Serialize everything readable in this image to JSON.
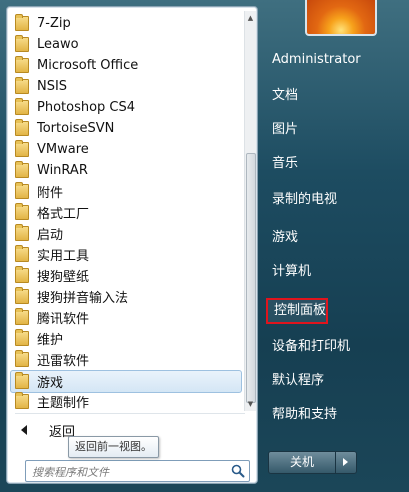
{
  "programs": [
    {
      "label": "7-Zip"
    },
    {
      "label": "Leawo"
    },
    {
      "label": "Microsoft Office"
    },
    {
      "label": "NSIS"
    },
    {
      "label": "Photoshop CS4"
    },
    {
      "label": "TortoiseSVN"
    },
    {
      "label": "VMware"
    },
    {
      "label": "WinRAR"
    },
    {
      "label": "附件"
    },
    {
      "label": "格式工厂"
    },
    {
      "label": "启动"
    },
    {
      "label": "实用工具"
    },
    {
      "label": "搜狗壁纸"
    },
    {
      "label": "搜狗拼音输入法"
    },
    {
      "label": "腾讯软件"
    },
    {
      "label": "维护"
    },
    {
      "label": "迅雷软件"
    },
    {
      "label": "游戏",
      "selected": true
    },
    {
      "label": "主题制作"
    }
  ],
  "back": {
    "label": "返回"
  },
  "tooltip": {
    "text": "返回前一视图。"
  },
  "search": {
    "placeholder": "搜索程序和文件"
  },
  "right_pane": {
    "user": "Administrator",
    "links": [
      {
        "label": "文档"
      },
      {
        "label": "图片"
      },
      {
        "label": "音乐"
      },
      {
        "label": "录制的电视"
      },
      {
        "label": "游戏"
      },
      {
        "label": "计算机"
      },
      {
        "label": "控制面板",
        "highlighted": true
      },
      {
        "label": "设备和打印机"
      },
      {
        "label": "默认程序"
      },
      {
        "label": "帮助和支持"
      }
    ]
  },
  "shutdown": {
    "label": "关机"
  },
  "colors": {
    "highlight_border": "#e0141d",
    "menu_bg": "#1d4c61"
  }
}
